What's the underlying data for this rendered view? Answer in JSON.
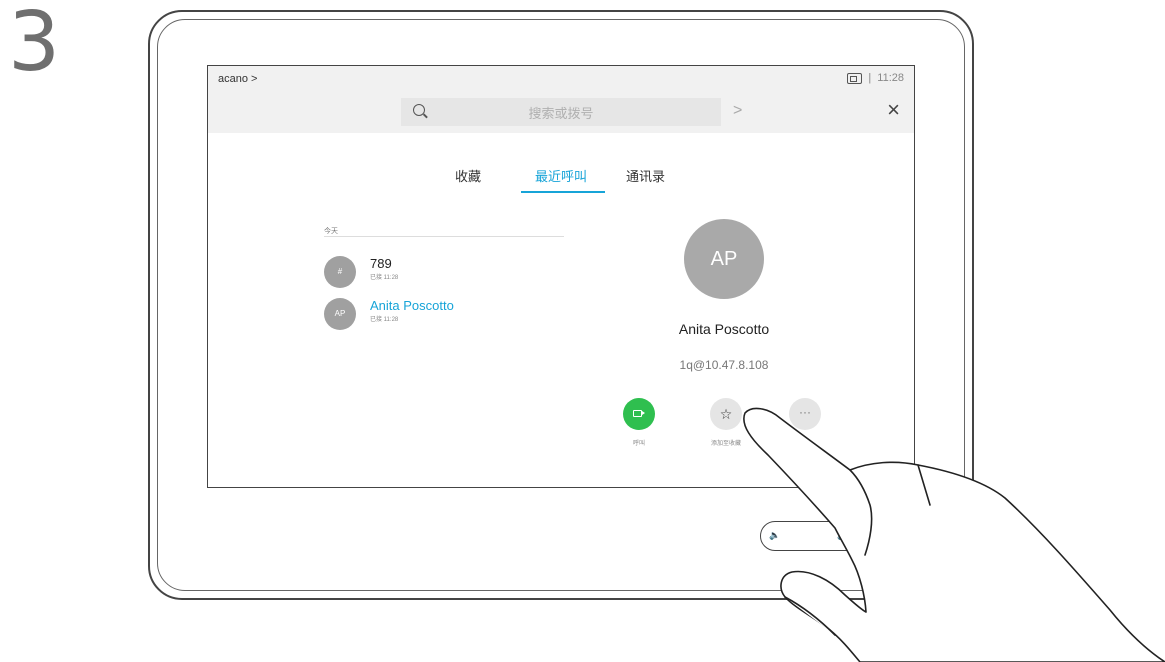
{
  "step": {
    "number": "3"
  },
  "header": {
    "breadcrumb": "acano >",
    "time": "11:28",
    "status_separator": "|"
  },
  "search": {
    "placeholder": "搜索或拨号",
    "go_arrow": ">",
    "close": "×"
  },
  "tabs": [
    {
      "label": "收藏",
      "active": false
    },
    {
      "label": "最近呼叫",
      "active": true
    },
    {
      "label": "通讯录",
      "active": false
    }
  ],
  "recents": {
    "section_label": "今天",
    "items": [
      {
        "avatar": "#",
        "name": "789",
        "subtitle": "已接 11:28"
      },
      {
        "avatar": "AP",
        "name": "Anita Poscotto",
        "subtitle": "已接 11:28"
      }
    ]
  },
  "detail": {
    "avatar": "AP",
    "name": "Anita Poscotto",
    "address": "1q@10.47.8.108",
    "actions": [
      {
        "icon": "video-call-icon",
        "label": "呼叫"
      },
      {
        "icon": "star-icon",
        "glyph": "☆",
        "label": "添加至收藏"
      },
      {
        "icon": "more-icon",
        "glyph": "···",
        "label": ""
      }
    ]
  },
  "colors": {
    "accent": "#17a4d8",
    "call_green": "#2fbf4f",
    "avatar_gray": "#a9a9a9"
  }
}
